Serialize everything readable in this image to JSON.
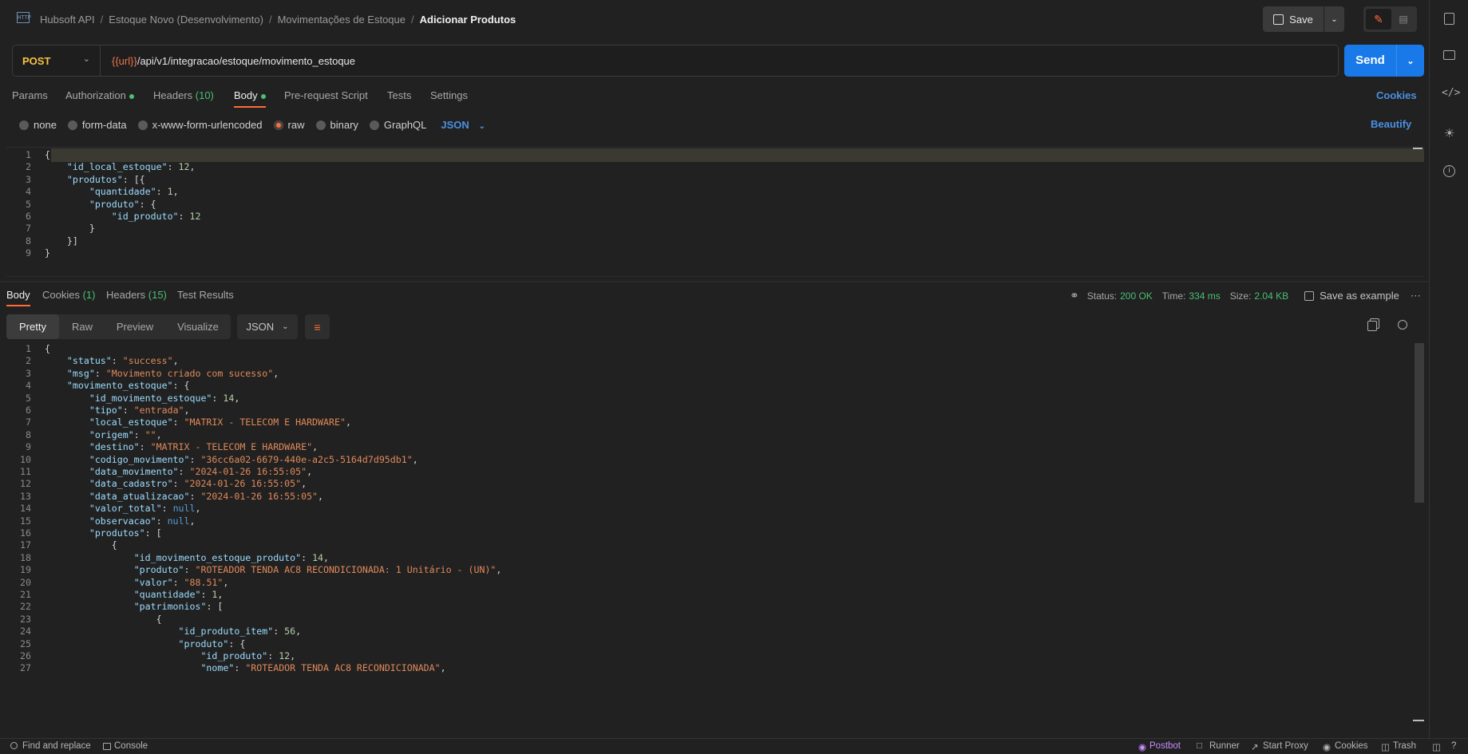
{
  "header": {
    "app_icon": "http-icon",
    "breadcrumb": [
      "Hubsoft API",
      "Estoque Novo (Desenvolvimento)",
      "Movimentações de Estoque"
    ],
    "current": "Adicionar Produtos",
    "save_label": "Save"
  },
  "request": {
    "method": "POST",
    "url_var": "{{url}}",
    "url_path": "/api/v1/integracao/estoque/movimento_estoque",
    "send_label": "Send"
  },
  "req_tabs": {
    "params": "Params",
    "authorization": "Authorization",
    "headers": "Headers",
    "headers_count": "(10)",
    "body": "Body",
    "prerequest": "Pre-request Script",
    "tests": "Tests",
    "settings": "Settings",
    "cookies": "Cookies"
  },
  "body_types": {
    "none": "none",
    "formdata": "form-data",
    "urlencoded": "x-www-form-urlencoded",
    "raw": "raw",
    "binary": "binary",
    "graphql": "GraphQL",
    "format": "JSON",
    "beautify": "Beautify"
  },
  "request_body": [
    {
      "n": "1",
      "html": "<span class=\"p\">{</span>"
    },
    {
      "n": "2",
      "html": "    <span class=\"k\">\"id_local_estoque\"</span><span class=\"p\">: </span><span class=\"n\">12</span><span class=\"p\">,</span>"
    },
    {
      "n": "3",
      "html": "    <span class=\"k\">\"produtos\"</span><span class=\"p\">: [{</span>"
    },
    {
      "n": "4",
      "html": "        <span class=\"k\">\"quantidade\"</span><span class=\"p\">: </span><span class=\"n\">1</span><span class=\"p\">,</span>"
    },
    {
      "n": "5",
      "html": "        <span class=\"k\">\"produto\"</span><span class=\"p\">: {</span>"
    },
    {
      "n": "6",
      "html": "            <span class=\"k\">\"id_produto\"</span><span class=\"p\">: </span><span class=\"n\">12</span>"
    },
    {
      "n": "7",
      "html": "        <span class=\"p\">}</span>"
    },
    {
      "n": "8",
      "html": "    <span class=\"p\">}]</span>"
    },
    {
      "n": "9",
      "html": "<span class=\"p\">}</span>"
    }
  ],
  "resp_tabs": {
    "body": "Body",
    "cookies": "Cookies",
    "cookies_count": "(1)",
    "headers": "Headers",
    "headers_count": "(15)",
    "tests": "Test Results"
  },
  "resp_status": {
    "status_label": "Status:",
    "status_value": "200 OK",
    "time_label": "Time:",
    "time_value": "334 ms",
    "size_label": "Size:",
    "size_value": "2.04 KB",
    "save_example": "Save as example"
  },
  "resp_view": {
    "pretty": "Pretty",
    "raw": "Raw",
    "preview": "Preview",
    "visualize": "Visualize",
    "format": "JSON"
  },
  "response_body": [
    {
      "n": "1",
      "html": "<span class=\"p\">{</span>"
    },
    {
      "n": "2",
      "html": "    <span class=\"k\">\"status\"</span><span class=\"p\">: </span><span class=\"s\">\"success\"</span><span class=\"p\">,</span>"
    },
    {
      "n": "3",
      "html": "    <span class=\"k\">\"msg\"</span><span class=\"p\">: </span><span class=\"s\">\"Movimento criado com sucesso\"</span><span class=\"p\">,</span>"
    },
    {
      "n": "4",
      "html": "    <span class=\"k\">\"movimento_estoque\"</span><span class=\"p\">: {</span>"
    },
    {
      "n": "5",
      "html": "        <span class=\"k\">\"id_movimento_estoque\"</span><span class=\"p\">: </span><span class=\"n\">14</span><span class=\"p\">,</span>"
    },
    {
      "n": "6",
      "html": "        <span class=\"k\">\"tipo\"</span><span class=\"p\">: </span><span class=\"s\">\"entrada\"</span><span class=\"p\">,</span>"
    },
    {
      "n": "7",
      "html": "        <span class=\"k\">\"local_estoque\"</span><span class=\"p\">: </span><span class=\"s\">\"MATRIX - TELECOM E HARDWARE\"</span><span class=\"p\">,</span>"
    },
    {
      "n": "8",
      "html": "        <span class=\"k\">\"origem\"</span><span class=\"p\">: </span><span class=\"s\">\"\"</span><span class=\"p\">,</span>"
    },
    {
      "n": "9",
      "html": "        <span class=\"k\">\"destino\"</span><span class=\"p\">: </span><span class=\"s\">\"MATRIX - TELECOM E HARDWARE\"</span><span class=\"p\">,</span>"
    },
    {
      "n": "10",
      "html": "        <span class=\"k\">\"codigo_movimento\"</span><span class=\"p\">: </span><span class=\"s\">\"36cc6a02-6679-440e-a2c5-5164d7d95db1\"</span><span class=\"p\">,</span>"
    },
    {
      "n": "11",
      "html": "        <span class=\"k\">\"data_movimento\"</span><span class=\"p\">: </span><span class=\"s\">\"2024-01-26 16:55:05\"</span><span class=\"p\">,</span>"
    },
    {
      "n": "12",
      "html": "        <span class=\"k\">\"data_cadastro\"</span><span class=\"p\">: </span><span class=\"s\">\"2024-01-26 16:55:05\"</span><span class=\"p\">,</span>"
    },
    {
      "n": "13",
      "html": "        <span class=\"k\">\"data_atualizacao\"</span><span class=\"p\">: </span><span class=\"s\">\"2024-01-26 16:55:05\"</span><span class=\"p\">,</span>"
    },
    {
      "n": "14",
      "html": "        <span class=\"k\">\"valor_total\"</span><span class=\"p\">: </span><span class=\"kw\">null</span><span class=\"p\">,</span>"
    },
    {
      "n": "15",
      "html": "        <span class=\"k\">\"observacao\"</span><span class=\"p\">: </span><span class=\"kw\">null</span><span class=\"p\">,</span>"
    },
    {
      "n": "16",
      "html": "        <span class=\"k\">\"produtos\"</span><span class=\"p\">: [</span>"
    },
    {
      "n": "17",
      "html": "            <span class=\"p\">{</span>"
    },
    {
      "n": "18",
      "html": "                <span class=\"k\">\"id_movimento_estoque_produto\"</span><span class=\"p\">: </span><span class=\"n\">14</span><span class=\"p\">,</span>"
    },
    {
      "n": "19",
      "html": "                <span class=\"k\">\"produto\"</span><span class=\"p\">: </span><span class=\"s\">\"ROTEADOR TENDA AC8 RECONDICIONADA: 1 Unitário - (UN)\"</span><span class=\"p\">,</span>"
    },
    {
      "n": "20",
      "html": "                <span class=\"k\">\"valor\"</span><span class=\"p\">: </span><span class=\"s\">\"88.51\"</span><span class=\"p\">,</span>"
    },
    {
      "n": "21",
      "html": "                <span class=\"k\">\"quantidade\"</span><span class=\"p\">: </span><span class=\"n\">1</span><span class=\"p\">,</span>"
    },
    {
      "n": "22",
      "html": "                <span class=\"k\">\"patrimonios\"</span><span class=\"p\">: [</span>"
    },
    {
      "n": "23",
      "html": "                    <span class=\"p\">{</span>"
    },
    {
      "n": "24",
      "html": "                        <span class=\"k\">\"id_produto_item\"</span><span class=\"p\">: </span><span class=\"n\">56</span><span class=\"p\">,</span>"
    },
    {
      "n": "25",
      "html": "                        <span class=\"k\">\"produto\"</span><span class=\"p\">: {</span>"
    },
    {
      "n": "26",
      "html": "                            <span class=\"k\">\"id_produto\"</span><span class=\"p\">: </span><span class=\"n\">12</span><span class=\"p\">,</span>"
    },
    {
      "n": "27",
      "html": "                            <span class=\"k\">\"nome\"</span><span class=\"p\">: </span><span class=\"s\">\"ROTEADOR TENDA AC8 RECONDICIONADA\"</span><span class=\"p\">,</span>"
    }
  ],
  "footer": {
    "find_replace": "Find and replace",
    "console": "Console",
    "postbot": "Postbot",
    "runner": "Runner",
    "start_proxy": "Start Proxy",
    "cookies": "Cookies",
    "trash": "Trash"
  },
  "colors": {
    "accent": "#1a79e8",
    "method": "#f6c344",
    "status_ok": "#4bbf73",
    "active_tab": "#ff6c37"
  }
}
